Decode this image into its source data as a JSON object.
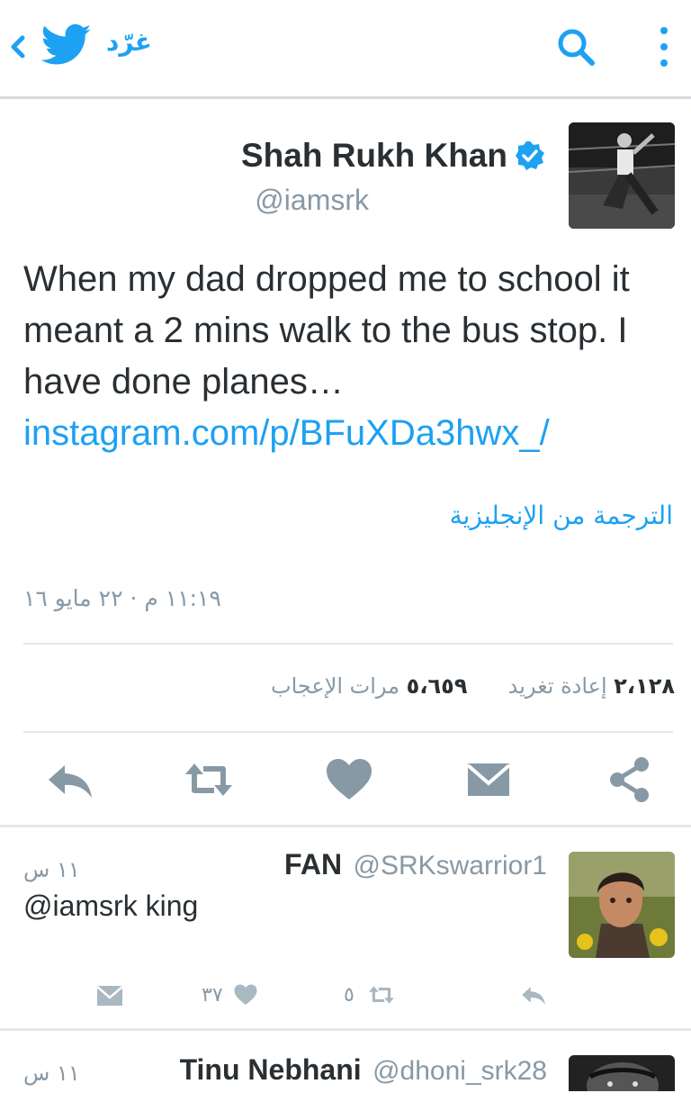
{
  "topbar": {
    "tweet_label": "غرّد",
    "icons": [
      "back-chevron-icon",
      "twitter-bird-icon",
      "search-icon",
      "more-vertical-icon"
    ],
    "accent": "#1da1f2"
  },
  "tweet": {
    "author_name": "Shah Rukh Khan",
    "author_handle": "@iamsrk",
    "text": "When my dad dropped me to school it meant a 2 mins walk to the bus stop. I have done planes…",
    "link": "instagram.com/p/BFuXDa3hwx_/",
    "translate_label": "الترجمة من الإنجليزية",
    "timestamp": "١١:١٩ م · ٢٢ مايو ١٦",
    "retweets_count": "٢،١٢٨",
    "retweets_label": "إعادة تغريد",
    "likes_count": "٥،٦٥٩",
    "likes_label": "مرات الإعجاب",
    "actions": [
      "reply-icon",
      "retweet-icon",
      "like-icon",
      "dm-icon",
      "share-icon"
    ]
  },
  "replies": [
    {
      "name": "FAN",
      "handle": "@SRKswarrior1",
      "time": "١١ س",
      "text": "@iamsrk king",
      "likes": "٣٧",
      "retweets": "٥"
    },
    {
      "name": "Tinu Nebhani",
      "handle": "@dhoni_srk28",
      "time": "١١ س"
    }
  ]
}
